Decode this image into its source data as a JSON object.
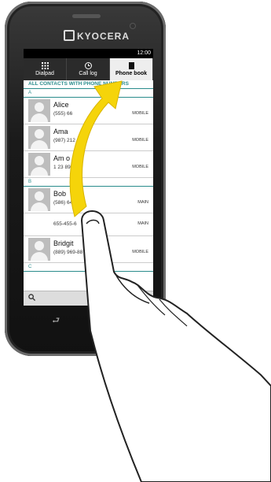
{
  "device": {
    "brand": "KYOCERA"
  },
  "status": {
    "time": "12:00"
  },
  "tabs": [
    {
      "label": "Dialpad",
      "icon": "grid-icon"
    },
    {
      "label": "Call log",
      "icon": "clock-icon"
    },
    {
      "label": "Phone book",
      "icon": "book-icon"
    }
  ],
  "filter": "ALL CONTACTS WITH PHONE NUMBERS",
  "sections": {
    "a": "A",
    "b": "B",
    "c": "C"
  },
  "contacts": [
    {
      "name": "Alice",
      "number": "(555) 66",
      "type": "MOBILE"
    },
    {
      "name": "Ama",
      "number": "(987) 212",
      "type": "MOBILE"
    },
    {
      "name": "Am o",
      "number": "1 23 899",
      "type": "MOBILE"
    },
    {
      "name": "Bob",
      "number": "(586) 64",
      "type": "MAIN"
    },
    {
      "name": "",
      "number": "655-455-6",
      "type": "MAIN"
    },
    {
      "name": "Bridgit",
      "number": "(889) 969-88",
      "type": "MOBILE"
    }
  ],
  "nav": {
    "back": "⮐",
    "home": "⌂"
  },
  "colors": {
    "accent": "#2a8c8c",
    "swipe_arrow": "#f5d40a"
  }
}
